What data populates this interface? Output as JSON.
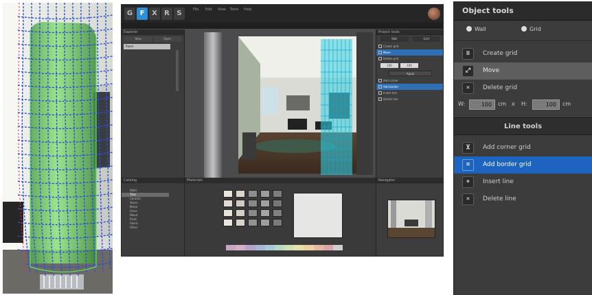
{
  "app": {
    "logo_letters": [
      "G",
      "F",
      "X",
      "R",
      "S"
    ],
    "menu": [
      "File",
      "Edit",
      "View",
      "Tools",
      "Help"
    ]
  },
  "left_tree": {
    "header": "Explorer",
    "tabs": [
      "New",
      "Open"
    ],
    "selected_row": "Room"
  },
  "mid_right_panel": {
    "header": "Project tools",
    "modes": [
      "Wall",
      "Grid"
    ],
    "items": [
      "Create grid",
      "Move",
      "Delete grid",
      "Add corner",
      "Add border",
      "Insert line",
      "Delete line"
    ],
    "inputs": [
      "100",
      "100"
    ],
    "button": "Apply"
  },
  "bottom_panels": {
    "catalog_header": "Catalog",
    "tree_items": [
      "Walls",
      "Tiles",
      "Ceramic",
      "Stone",
      "Metal",
      "Glass",
      "Wood",
      "Paint",
      "Fabric",
      "Other"
    ],
    "material_header": "Materials",
    "navigator_header": "Navigator"
  },
  "object_tools": {
    "title": "Object tools",
    "modes": [
      {
        "label": "Wall",
        "icon": "radio-icon"
      },
      {
        "label": "Grid",
        "icon": "radio-icon"
      }
    ],
    "tools": [
      {
        "label": "Create grid",
        "icon": "grid-create-icon",
        "state": "normal"
      },
      {
        "label": "Move",
        "icon": "move-icon",
        "state": "hover"
      },
      {
        "label": "Delete grid",
        "icon": "delete-grid-icon",
        "state": "normal"
      }
    ],
    "dims": {
      "w_label": "W:",
      "w_value": "100",
      "w_unit": "cm",
      "x_label": "x",
      "h_label": "H:",
      "h_value": "100",
      "h_unit": "cm"
    },
    "line_tools_title": "Line tools",
    "line_tools": [
      {
        "label": "Add corner grid",
        "icon": "add-corner-icon",
        "state": "normal"
      },
      {
        "label": "Add border grid",
        "icon": "add-border-icon",
        "state": "selected"
      },
      {
        "label": "Insert line",
        "icon": "insert-line-icon",
        "state": "normal"
      },
      {
        "label": "Delete line",
        "icon": "delete-line-icon",
        "state": "normal"
      }
    ]
  },
  "colors": {
    "accent_blue": "#1c64c0",
    "grid_green": "#5fe06a",
    "grid_blue": "#2c4fd8",
    "grid_cyan": "#34d2e8"
  }
}
